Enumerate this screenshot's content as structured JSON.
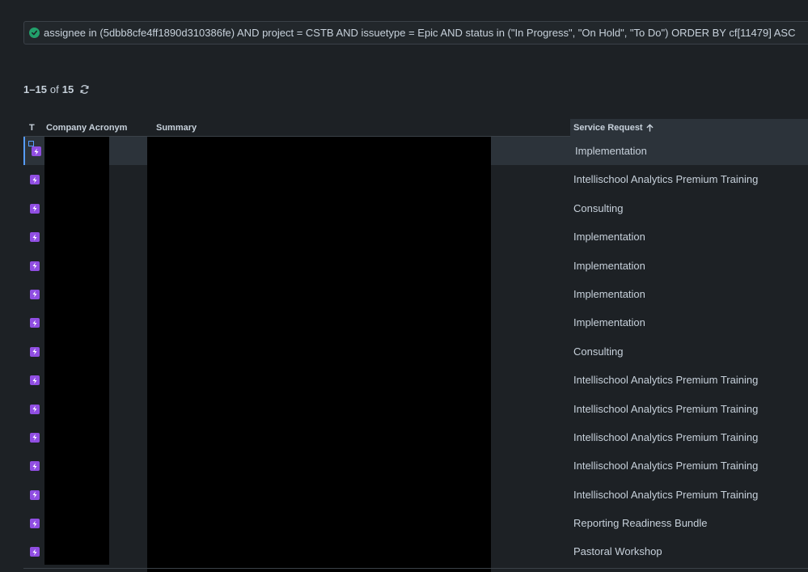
{
  "jql": {
    "query": "assignee in (5dbb8cfe4ff1890d310386fe) AND project = CSTB AND issuetype = Epic AND status in (\"In Progress\", \"On Hold\", \"To Do\") ORDER BY cf[11479] ASC",
    "status_icon": "check-circle-icon",
    "status_color": "#22a06b"
  },
  "results": {
    "range": "1–15",
    "of_label": "of",
    "total": "15",
    "refresh_icon": "refresh-icon"
  },
  "table": {
    "columns": {
      "type": "T",
      "company": "Company Acronym",
      "summary": "Summary",
      "service": "Service Request"
    },
    "sort_icon": "arrow-up-icon",
    "epic_color": "#904ee2",
    "rows": [
      {
        "service": "Implementation"
      },
      {
        "service": "Intellischool Analytics Premium Training"
      },
      {
        "service": "Consulting"
      },
      {
        "service": "Implementation"
      },
      {
        "service": "Implementation"
      },
      {
        "service": "Implementation"
      },
      {
        "service": "Implementation"
      },
      {
        "service": "Consulting"
      },
      {
        "service": "Intellischool Analytics Premium Training"
      },
      {
        "service": "Intellischool Analytics Premium Training"
      },
      {
        "service": "Intellischool Analytics Premium Training"
      },
      {
        "service": "Intellischool Analytics Premium Training"
      },
      {
        "service": "Intellischool Analytics Premium Training"
      },
      {
        "service": "Reporting Readiness Bundle"
      },
      {
        "service": "Pastoral Workshop"
      }
    ]
  }
}
